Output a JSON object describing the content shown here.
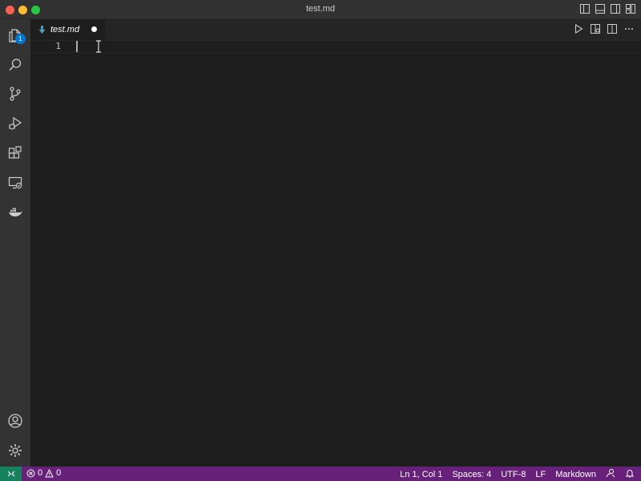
{
  "window": {
    "title": "test.md"
  },
  "activity_bar": {
    "explorer_badge": "1",
    "items": [
      "files-icon",
      "search-icon",
      "source-control-icon",
      "run-debug-icon",
      "extensions-icon",
      "remote-explorer-icon",
      "docker-icon"
    ],
    "bottom_items": [
      "account-icon",
      "settings-gear-icon"
    ]
  },
  "tabs": [
    {
      "label": "test.md",
      "icon": "markdown-arrow-icon",
      "dirty": true,
      "active": true
    }
  ],
  "editor": {
    "lines": [
      {
        "number": "1",
        "text": ""
      }
    ]
  },
  "status_bar": {
    "errors": "0",
    "warnings": "0",
    "cursor_position": "Ln 1, Col 1",
    "indentation": "Spaces: 4",
    "encoding": "UTF-8",
    "line_ending": "LF",
    "language": "Markdown"
  },
  "colors": {
    "status_bar": "#68217a",
    "remote_indicator": "#16825d",
    "badge": "#0078d4",
    "editor_bg": "#1e1e1e",
    "activity_bar": "#333333"
  }
}
